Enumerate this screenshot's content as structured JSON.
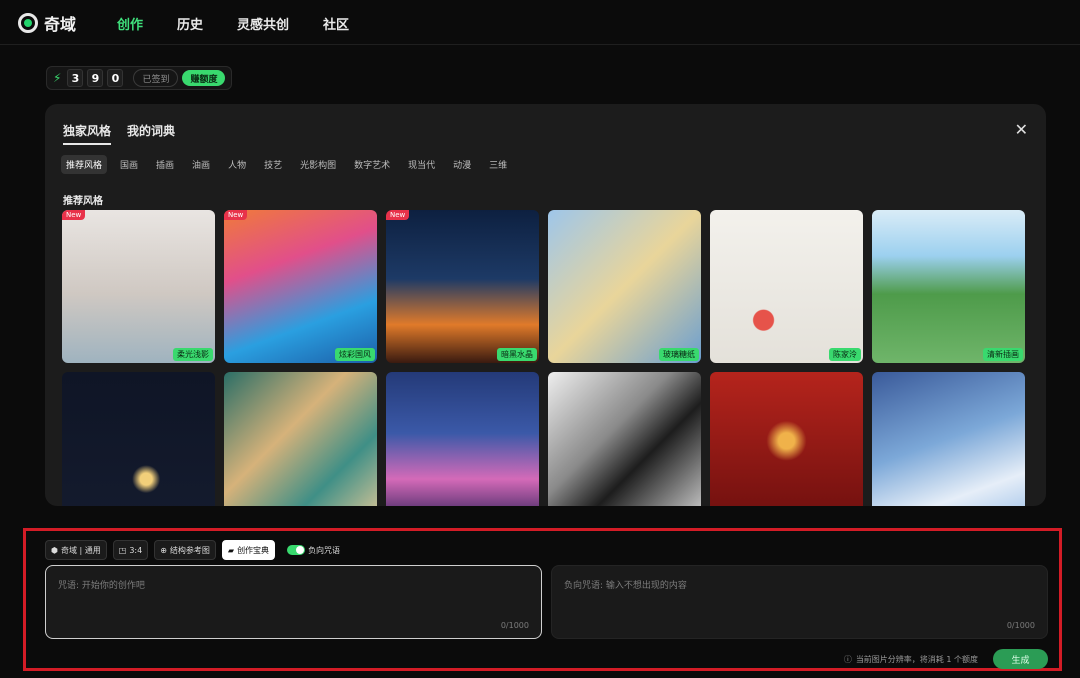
{
  "app": {
    "name": "奇域"
  },
  "nav": [
    "创作",
    "历史",
    "灵感共创",
    "社区"
  ],
  "credits": {
    "digits": [
      "3",
      "9",
      "0"
    ],
    "checked_in": "已签到",
    "earn": "赚额度"
  },
  "styles_panel": {
    "tabs": [
      "独家风格",
      "我的词典"
    ],
    "categories": [
      "推荐风格",
      "国画",
      "插画",
      "油画",
      "人物",
      "技艺",
      "光影构图",
      "数字艺术",
      "现当代",
      "动漫",
      "三维"
    ],
    "section_title": "推荐风格",
    "cards": [
      {
        "label": "柔光浅影",
        "new": "New"
      },
      {
        "label": "炫彩国风",
        "new": "New"
      },
      {
        "label": "暗黑水晶",
        "new": "New"
      },
      {
        "label": "玻璃糖纸",
        "new": ""
      },
      {
        "label": "陈家泠",
        "new": ""
      },
      {
        "label": "清新插画",
        "new": ""
      },
      {
        "label": "",
        "new": ""
      },
      {
        "label": "",
        "new": ""
      },
      {
        "label": "",
        "new": ""
      },
      {
        "label": "",
        "new": ""
      },
      {
        "label": "",
        "new": ""
      },
      {
        "label": "",
        "new": ""
      }
    ]
  },
  "composer": {
    "model": "奇域 | 通用",
    "ratio": "3:4",
    "ref": "结构参考图",
    "dict": "创作宝典",
    "neg_toggle": "负向咒语",
    "prompt_placeholder": "咒语: 开始你的创作吧",
    "neg_placeholder": "负向咒语: 输入不想出现的内容",
    "count": "0/1000",
    "note": "当前图片分辨率，将消耗 1 个额度",
    "generate": "生成"
  },
  "colors": {
    "accent": "#39d96e",
    "highlight": "#d31c26"
  }
}
